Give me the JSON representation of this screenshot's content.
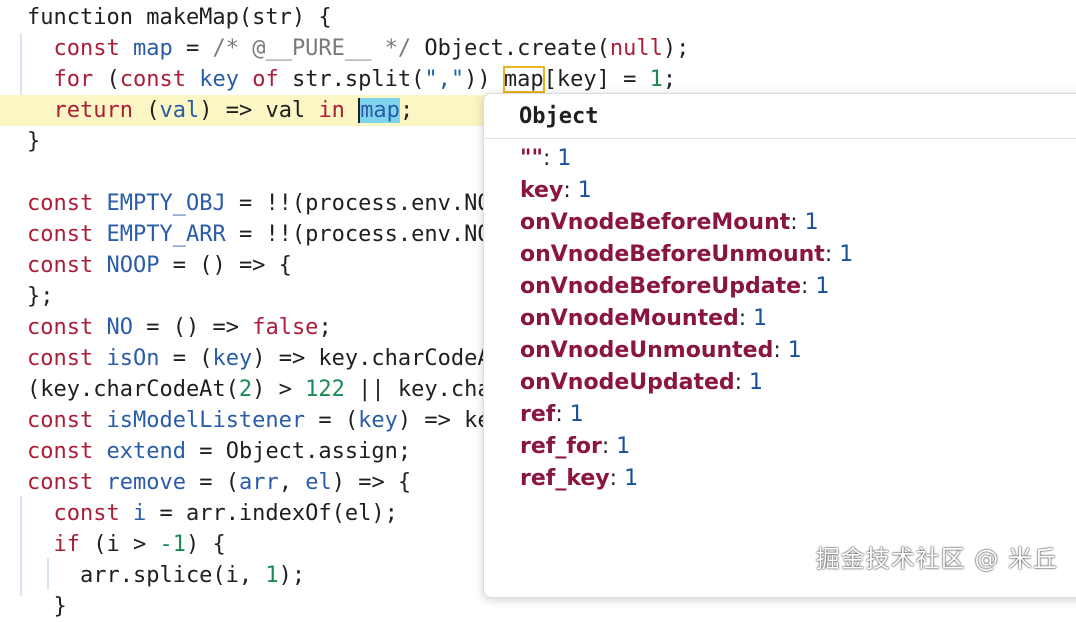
{
  "code": {
    "lines": [
      {
        "parts": [
          [
            "fn",
            "function makeMap("
          ],
          [
            "var",
            ""
          ],
          [
            "op",
            "str) {"
          ]
        ]
      },
      {
        "parts": [
          [
            "kw",
            "  const "
          ],
          [
            "var",
            "map"
          ],
          [
            "op",
            " = "
          ],
          [
            "cmt",
            "/* @__PURE__ */"
          ],
          [
            "op",
            " Object.create("
          ],
          [
            "kw",
            "null"
          ],
          [
            "op",
            ");"
          ]
        ]
      },
      {
        "parts": [
          [
            "kw",
            "  for "
          ],
          [
            "op",
            "("
          ],
          [
            "kw",
            "const "
          ],
          [
            "var",
            "key "
          ],
          [
            "kw",
            "of "
          ],
          [
            "op",
            "str.split("
          ],
          [
            "str",
            "\",\""
          ],
          [
            "op",
            ")) "
          ],
          [
            "boxed",
            "map"
          ],
          [
            "op",
            "[key] = "
          ],
          [
            "num",
            "1"
          ],
          [
            "op",
            ";"
          ]
        ]
      },
      {
        "parts": [
          [
            "kw",
            "  return "
          ],
          [
            "op",
            "("
          ],
          [
            "var",
            "val"
          ],
          [
            "op",
            ") => val "
          ],
          [
            "kw",
            "in "
          ],
          [
            "sel",
            "map"
          ],
          [
            "op",
            ";"
          ]
        ]
      },
      {
        "parts": [
          [
            "op",
            "}"
          ]
        ]
      },
      {
        "parts": [
          [
            "op",
            ""
          ]
        ]
      },
      {
        "parts": [
          [
            "kw",
            "const "
          ],
          [
            "var",
            "EMPTY_OBJ"
          ],
          [
            "op",
            " = !!(process.env.NO"
          ]
        ]
      },
      {
        "parts": [
          [
            "kw",
            "const "
          ],
          [
            "var",
            "EMPTY_ARR"
          ],
          [
            "op",
            " = !!(process.env.NO"
          ]
        ]
      },
      {
        "parts": [
          [
            "kw",
            "const "
          ],
          [
            "var",
            "NOOP"
          ],
          [
            "op",
            " = () => {"
          ]
        ]
      },
      {
        "parts": [
          [
            "op",
            "};"
          ]
        ]
      },
      {
        "parts": [
          [
            "kw",
            "const "
          ],
          [
            "var",
            "NO"
          ],
          [
            "op",
            " = () => "
          ],
          [
            "kw",
            "false"
          ],
          [
            "op",
            ";"
          ]
        ]
      },
      {
        "parts": [
          [
            "kw",
            "const "
          ],
          [
            "var",
            "isOn"
          ],
          [
            "op",
            " = ("
          ],
          [
            "var",
            "key"
          ],
          [
            "op",
            ") => key.charCodeAt"
          ]
        ]
      },
      {
        "parts": [
          [
            "op",
            "(key.charCodeAt("
          ],
          [
            "num",
            "2"
          ],
          [
            "op",
            ") > "
          ],
          [
            "num",
            "122"
          ],
          [
            "op",
            " || key.cha"
          ]
        ]
      },
      {
        "parts": [
          [
            "kw",
            "const "
          ],
          [
            "var",
            "isModelListener"
          ],
          [
            "op",
            " = ("
          ],
          [
            "var",
            "key"
          ],
          [
            "op",
            ") => ke"
          ]
        ]
      },
      {
        "parts": [
          [
            "kw",
            "const "
          ],
          [
            "var",
            "extend"
          ],
          [
            "op",
            " = Object.assign;"
          ]
        ]
      },
      {
        "parts": [
          [
            "kw",
            "const "
          ],
          [
            "var",
            "remove"
          ],
          [
            "op",
            " = ("
          ],
          [
            "var",
            "arr"
          ],
          [
            "op",
            ", "
          ],
          [
            "var",
            "el"
          ],
          [
            "op",
            ") => {"
          ]
        ]
      },
      {
        "parts": [
          [
            "kw",
            "  const "
          ],
          [
            "var",
            "i"
          ],
          [
            "op",
            " = arr.indexOf(el);"
          ]
        ]
      },
      {
        "parts": [
          [
            "kw",
            "  if "
          ],
          [
            "op",
            "(i > "
          ],
          [
            "num",
            "-1"
          ],
          [
            "op",
            ") {"
          ]
        ]
      },
      {
        "parts": [
          [
            "op",
            "    arr.splice(i, "
          ],
          [
            "num",
            "1"
          ],
          [
            "op",
            ");"
          ]
        ]
      },
      {
        "parts": [
          [
            "op",
            "  }"
          ]
        ]
      }
    ]
  },
  "hover": {
    "title": "Object",
    "properties": [
      {
        "key": "\"\"",
        "value": "1"
      },
      {
        "key": "key",
        "value": "1"
      },
      {
        "key": "onVnodeBeforeMount",
        "value": "1"
      },
      {
        "key": "onVnodeBeforeUnmount",
        "value": "1"
      },
      {
        "key": "onVnodeBeforeUpdate",
        "value": "1"
      },
      {
        "key": "onVnodeMounted",
        "value": "1"
      },
      {
        "key": "onVnodeUnmounted",
        "value": "1"
      },
      {
        "key": "onVnodeUpdated",
        "value": "1"
      },
      {
        "key": "ref",
        "value": "1"
      },
      {
        "key": "ref_for",
        "value": "1"
      },
      {
        "key": "ref_key",
        "value": "1"
      }
    ]
  },
  "watermark": "掘金技术社区 @ 米丘"
}
